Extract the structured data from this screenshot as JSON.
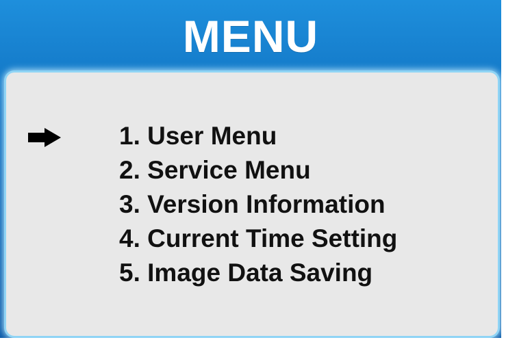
{
  "header": {
    "title": "MENU"
  },
  "menu": {
    "selected_index": 0,
    "selector_icon": "right-arrow-icon",
    "items": [
      {
        "label": "1. User Menu"
      },
      {
        "label": "2. Service Menu"
      },
      {
        "label": "3. Version Information"
      },
      {
        "label": "4. Current Time Setting"
      },
      {
        "label": "5. Image Data Saving"
      }
    ]
  },
  "colors": {
    "header_background": "#0f6fbf",
    "panel_background": "#e8e8e8",
    "panel_border_glow": "#8fd4f5",
    "title_text": "#ffffff",
    "item_text": "#111111"
  }
}
